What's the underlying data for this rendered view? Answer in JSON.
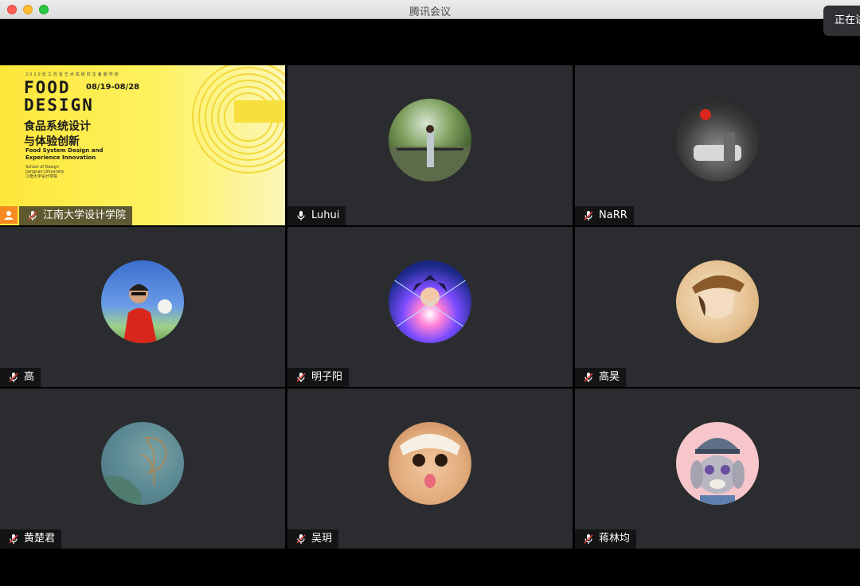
{
  "window": {
    "title": "腾讯会议"
  },
  "toast": {
    "text": "正在讲话"
  },
  "share_slide": {
    "top_line": "2020年江苏省艺术高研究生暑期学校",
    "logo_line1": "FOOD",
    "logo_line2": "DESIGN",
    "dates": "08/19-08/28",
    "title_cn_line1": "食品系统设计",
    "title_cn_line2": "与体验创新",
    "title_en_line1": "Food System Design and",
    "title_en_line2": "Experience Innovation",
    "school_en": "School of Design",
    "university_en": "Jiangnan University",
    "school_cn": "江南大学设计学院"
  },
  "participants": [
    {
      "name": "江南大学设计学院",
      "mic": "muted",
      "sharing": true
    },
    {
      "name": "Luhui",
      "mic": "on"
    },
    {
      "name": "NaRR",
      "mic": "muted"
    },
    {
      "name": "高",
      "mic": "muted"
    },
    {
      "name": "明子阳",
      "mic": "muted"
    },
    {
      "name": "高昊",
      "mic": "muted"
    },
    {
      "name": "黄楚君",
      "mic": "muted"
    },
    {
      "name": "吴玥",
      "mic": "muted"
    },
    {
      "name": "蒋林均",
      "mic": "muted"
    }
  ],
  "colors": {
    "tile_bg": "#2b2c2f",
    "mute_slash": "#e0403a",
    "user_badge": "#f68b1f",
    "slide_yellow": "#fde73a"
  }
}
